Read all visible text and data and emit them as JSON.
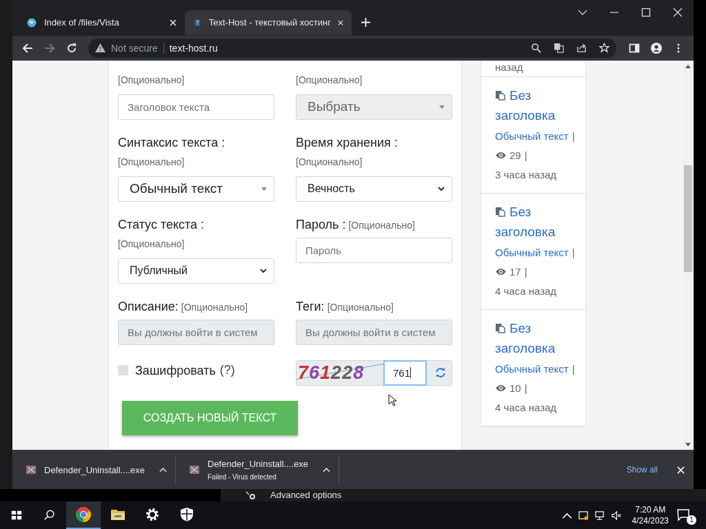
{
  "tabs": [
    {
      "title": "Index of /files/Vista",
      "selected": false
    },
    {
      "title": "Text-Host - текстовый хостинг",
      "selected": true
    }
  ],
  "address": {
    "security": "Not secure",
    "url": "text-host.ru"
  },
  "form": {
    "fields": [
      {
        "hint": "[Опционально]",
        "control": {
          "kind": "input",
          "placeholder": "Заголовок текста",
          "disabled": false
        }
      },
      {
        "hint": "[Опционально]",
        "control": {
          "kind": "dropdown",
          "value": "Выбрать",
          "disabled": true
        }
      },
      {
        "label": "Синтаксис текста :",
        "hint": "[Опционально]",
        "inline_hint": false,
        "control": {
          "kind": "dropdown",
          "value": "Обычный текст",
          "disabled": false
        }
      },
      {
        "label": "Время хранения :",
        "hint": "[Опционально]",
        "inline_hint": false,
        "control": {
          "kind": "select",
          "value": "Вечность",
          "disabled": false
        }
      },
      {
        "label": "Статус текста :",
        "hint": "[Опционально]",
        "inline_hint": false,
        "control": {
          "kind": "select",
          "value": "Публичный",
          "disabled": false
        }
      },
      {
        "label": "Пароль :",
        "hint": "[Опционально]",
        "inline_hint": true,
        "control": {
          "kind": "input",
          "placeholder": "Пароль",
          "disabled": false
        }
      },
      {
        "label": "Описание:",
        "hint": "[Опционально]",
        "inline_hint": true,
        "control": {
          "kind": "input",
          "placeholder": "Вы должны войти в систем",
          "disabled": true
        }
      },
      {
        "label": "Теги:",
        "hint": "[Опционально]",
        "inline_hint": true,
        "control": {
          "kind": "input",
          "placeholder": "Вы должны войти в систем",
          "disabled": true
        }
      }
    ],
    "encrypt": {
      "label": "Зашифровать",
      "help": "(?)",
      "checked": false
    },
    "captcha": {
      "code": [
        {
          "ch": "7",
          "color": "#c0392b"
        },
        {
          "ch": "6",
          "color": "#8e44ad"
        },
        {
          "ch": "1",
          "color": "#c0392b"
        },
        {
          "ch": "2",
          "color": "#6d5a5a"
        },
        {
          "ch": "2",
          "color": "#6d5a5a"
        },
        {
          "ch": "8",
          "color": "#8e44ad"
        }
      ],
      "value": "761",
      "focused": true
    },
    "submit": "СОЗДАТЬ НОВЫЙ ТЕКСТ"
  },
  "sidebar": {
    "top_fragment": "назад",
    "separator": "|",
    "items": [
      {
        "title": "Без заголовка",
        "syntax": "Обычный текст",
        "views": "29",
        "age": "3 часа назад"
      },
      {
        "title": "Без заголовка",
        "syntax": "Обычный текст",
        "views": "17",
        "age": "4 часа назад"
      },
      {
        "title": "Без заголовка",
        "syntax": "Обычный текст",
        "views": "10",
        "age": "4 часа назад"
      }
    ]
  },
  "downloads": {
    "items": [
      {
        "name": "Defender_Uninstall....exe"
      },
      {
        "name": "Defender_Uninstall....exe",
        "status": "Failed - Virus detected"
      }
    ],
    "show_all": "Show all"
  },
  "background_window": {
    "text": "Advanced options"
  },
  "taskbar": {
    "apps": [
      {
        "kind": "chrome",
        "active": true
      },
      {
        "kind": "folder",
        "active": false
      },
      {
        "kind": "settings",
        "active": false
      },
      {
        "kind": "shield",
        "active": false
      }
    ],
    "time": "7:20 AM",
    "date": "4/24/2023",
    "notifications": "1"
  }
}
